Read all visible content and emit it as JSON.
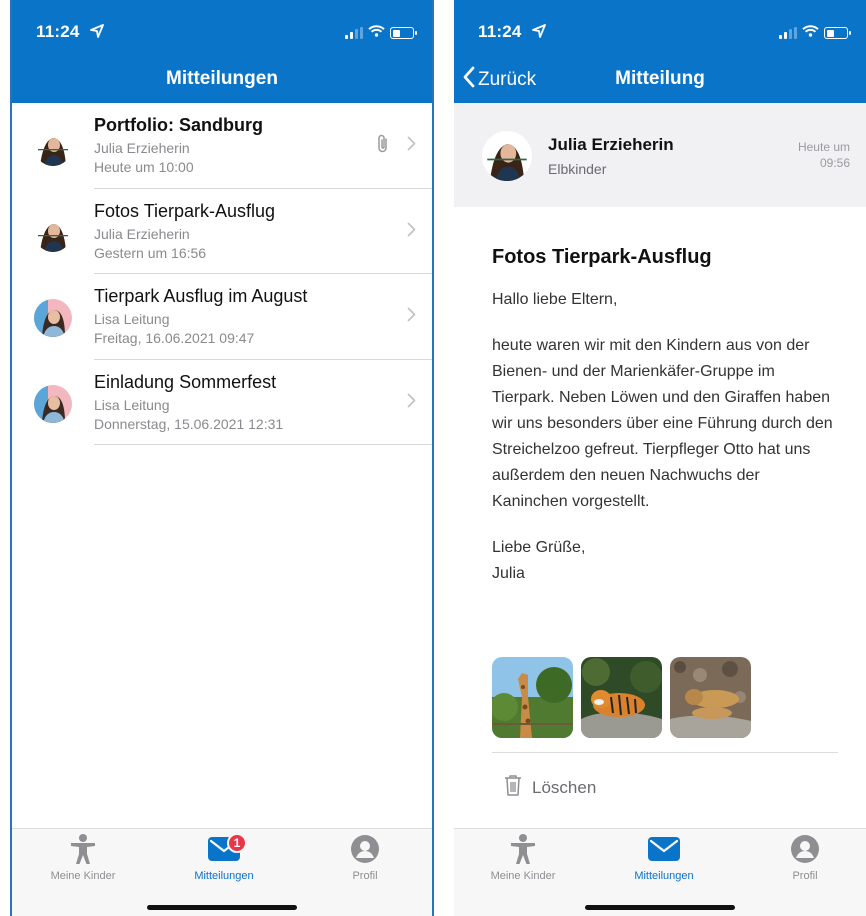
{
  "status_time": "11:24",
  "left": {
    "header_title": "Mitteilungen",
    "messages": [
      {
        "title": "Portfolio: Sandburg",
        "sender": "Julia Erzieherin",
        "date": "Heute um 10:00",
        "unread": true,
        "attachment": true
      },
      {
        "title": "Fotos Tierpark-Ausflug",
        "sender": "Julia Erzieherin",
        "date": "Gestern um 16:56",
        "unread": false,
        "attachment": false
      },
      {
        "title": "Tierpark Ausflug im August",
        "sender": "Lisa Leitung",
        "date": "Freitag, 16.06.2021 09:47",
        "unread": false,
        "attachment": false
      },
      {
        "title": "Einladung Sommerfest",
        "sender": "Lisa Leitung",
        "date": "Donnerstag, 15.06.2021 12:31",
        "unread": false,
        "attachment": false
      }
    ]
  },
  "right": {
    "back_label": "Zurück",
    "header_title": "Mitteilung",
    "sender_name": "Julia Erzieherin",
    "sender_org": "Elbkinder",
    "date": "Heute um 09:56",
    "message_title": "Fotos Tierpark-Ausflug",
    "greeting": "Hallo liebe Eltern,",
    "body": "heute waren wir mit den Kindern aus von der Bienen- und der Marienkäfer-Gruppe im Tierpark. Neben Löwen und den Giraffen haben wir uns besonders über eine Führung durch den Streichelzoo gefreut. Tierpfleger Otto hat uns außerdem den neuen Nachwuchs der Kaninchen vorgestellt.",
    "closing": "Liebe Grüße,",
    "signature": "Julia",
    "photos": [
      "giraffe",
      "tiger",
      "lions"
    ],
    "delete_label": "Löschen"
  },
  "tabs": {
    "kids": "Meine Kinder",
    "messages": "Mitteilungen",
    "profile": "Profil",
    "badge": "1"
  },
  "colors": {
    "brand_blue": "#0a74c9",
    "badge_red": "#e8374a",
    "tab_inactive": "#8e8e93"
  }
}
